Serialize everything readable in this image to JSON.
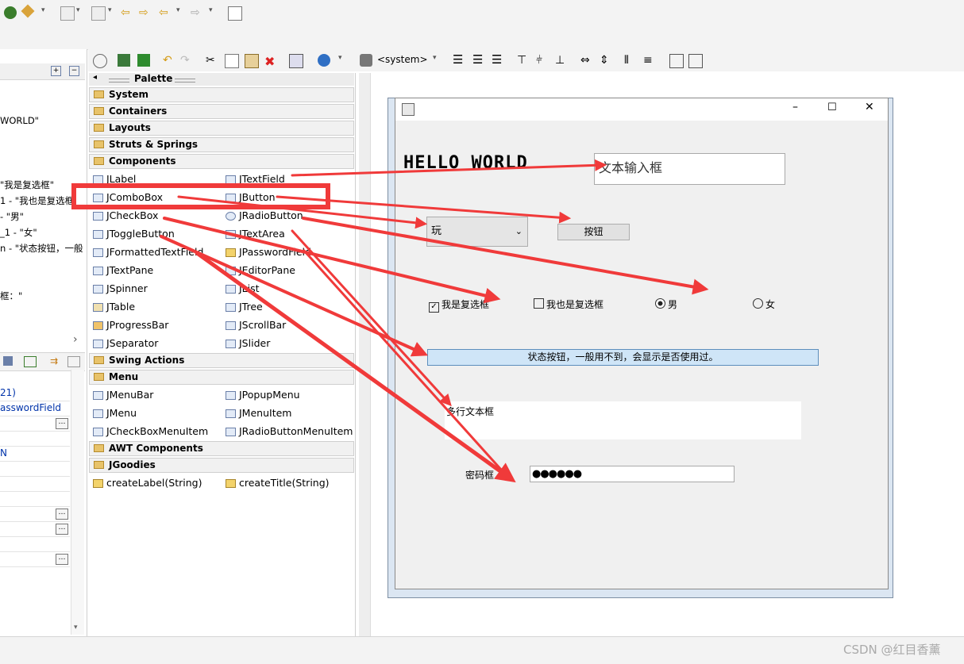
{
  "left_panel": {
    "lines": [
      "WORLD\"",
      "\"我是复选框\"",
      "1 - \"我也是复选框",
      "- \"男\"",
      "_1 - \"女\"",
      "n - \"状态按钮，一般",
      "框：\""
    ],
    "chevron": "›",
    "props": [
      "21)",
      "asswordField",
      "",
      "N",
      "",
      "",
      "",
      "",
      "",
      "",
      ""
    ]
  },
  "toolbar": {
    "system_label": "<system>"
  },
  "palette": {
    "title": "Palette",
    "categories": [
      "System",
      "Containers",
      "Layouts",
      "Struts & Springs",
      "Components",
      "Swing Actions",
      "Menu",
      "AWT Components",
      "JGoodies"
    ],
    "components": [
      [
        "JLabel",
        "JTextField"
      ],
      [
        "JComboBox",
        "JButton"
      ],
      [
        "JCheckBox",
        "JRadioButton"
      ],
      [
        "JToggleButton",
        "JTextArea"
      ],
      [
        "JFormattedTextField",
        "JPasswordField"
      ],
      [
        "JTextPane",
        "JEditorPane"
      ],
      [
        "JSpinner",
        "JList"
      ],
      [
        "JTable",
        "JTree"
      ],
      [
        "JProgressBar",
        "JScrollBar"
      ],
      [
        "JSeparator",
        "JSlider"
      ]
    ],
    "menu_items": [
      [
        "JMenuBar",
        "JPopupMenu"
      ],
      [
        "JMenu",
        "JMenuItem"
      ],
      [
        "JCheckBoxMenuItem",
        "JRadioButtonMenuItem"
      ]
    ],
    "jgoodies_items": [
      "createLabel(String)",
      "createTitle(String)"
    ]
  },
  "form": {
    "hello_label": "HELLO WORLD",
    "text_field": "文本输入框",
    "combo_value": "玩",
    "button_label": "按钮",
    "checkbox1": "我是复选框",
    "checkbox2": "我也是复选框",
    "radio_male": "男",
    "radio_female": "女",
    "toggle_label": "状态按钮，一般用不到，会显示是否使用过。",
    "textarea": "多行文本框",
    "password_label": "密码框",
    "password_value": "●●●●●●",
    "window_controls": {
      "minimize": "–",
      "maximize": "☐",
      "close": "✕"
    }
  },
  "watermark": "CSDN @红目香薰",
  "colors": {
    "annotation": "#f03a3a",
    "toggle_bg": "#cfe5f7",
    "toggle_border": "#5e8fbd"
  }
}
